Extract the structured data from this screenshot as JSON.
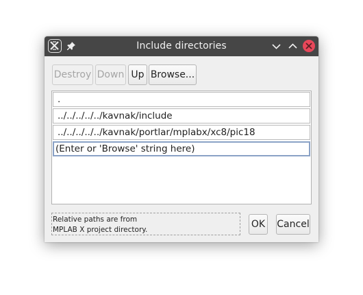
{
  "window": {
    "title": "Include directories"
  },
  "titlebar": {
    "icons": [
      "app-x-icon",
      "pin-icon",
      "minimize-icon",
      "maximize-icon",
      "close-icon"
    ],
    "close_color": "#e8475a",
    "bar_color": "#464646"
  },
  "toolbar": {
    "destroy_label": "Destroy",
    "down_label": "Down",
    "up_label": "Up",
    "browse_label": "Browse..."
  },
  "directories": [
    ".",
    "../../../../../kavnak/include",
    "../../../../../kavnak/portlar/mplabx/xc8/pic18"
  ],
  "new_entry_placeholder": "(Enter or 'Browse' string here)",
  "info": {
    "line1": "Relative paths are from",
    "line2": "MPLAB X project directory."
  },
  "actions": {
    "ok_label": "OK",
    "cancel_label": "Cancel"
  },
  "colors": {
    "focus_border": "#8aa2c6"
  }
}
